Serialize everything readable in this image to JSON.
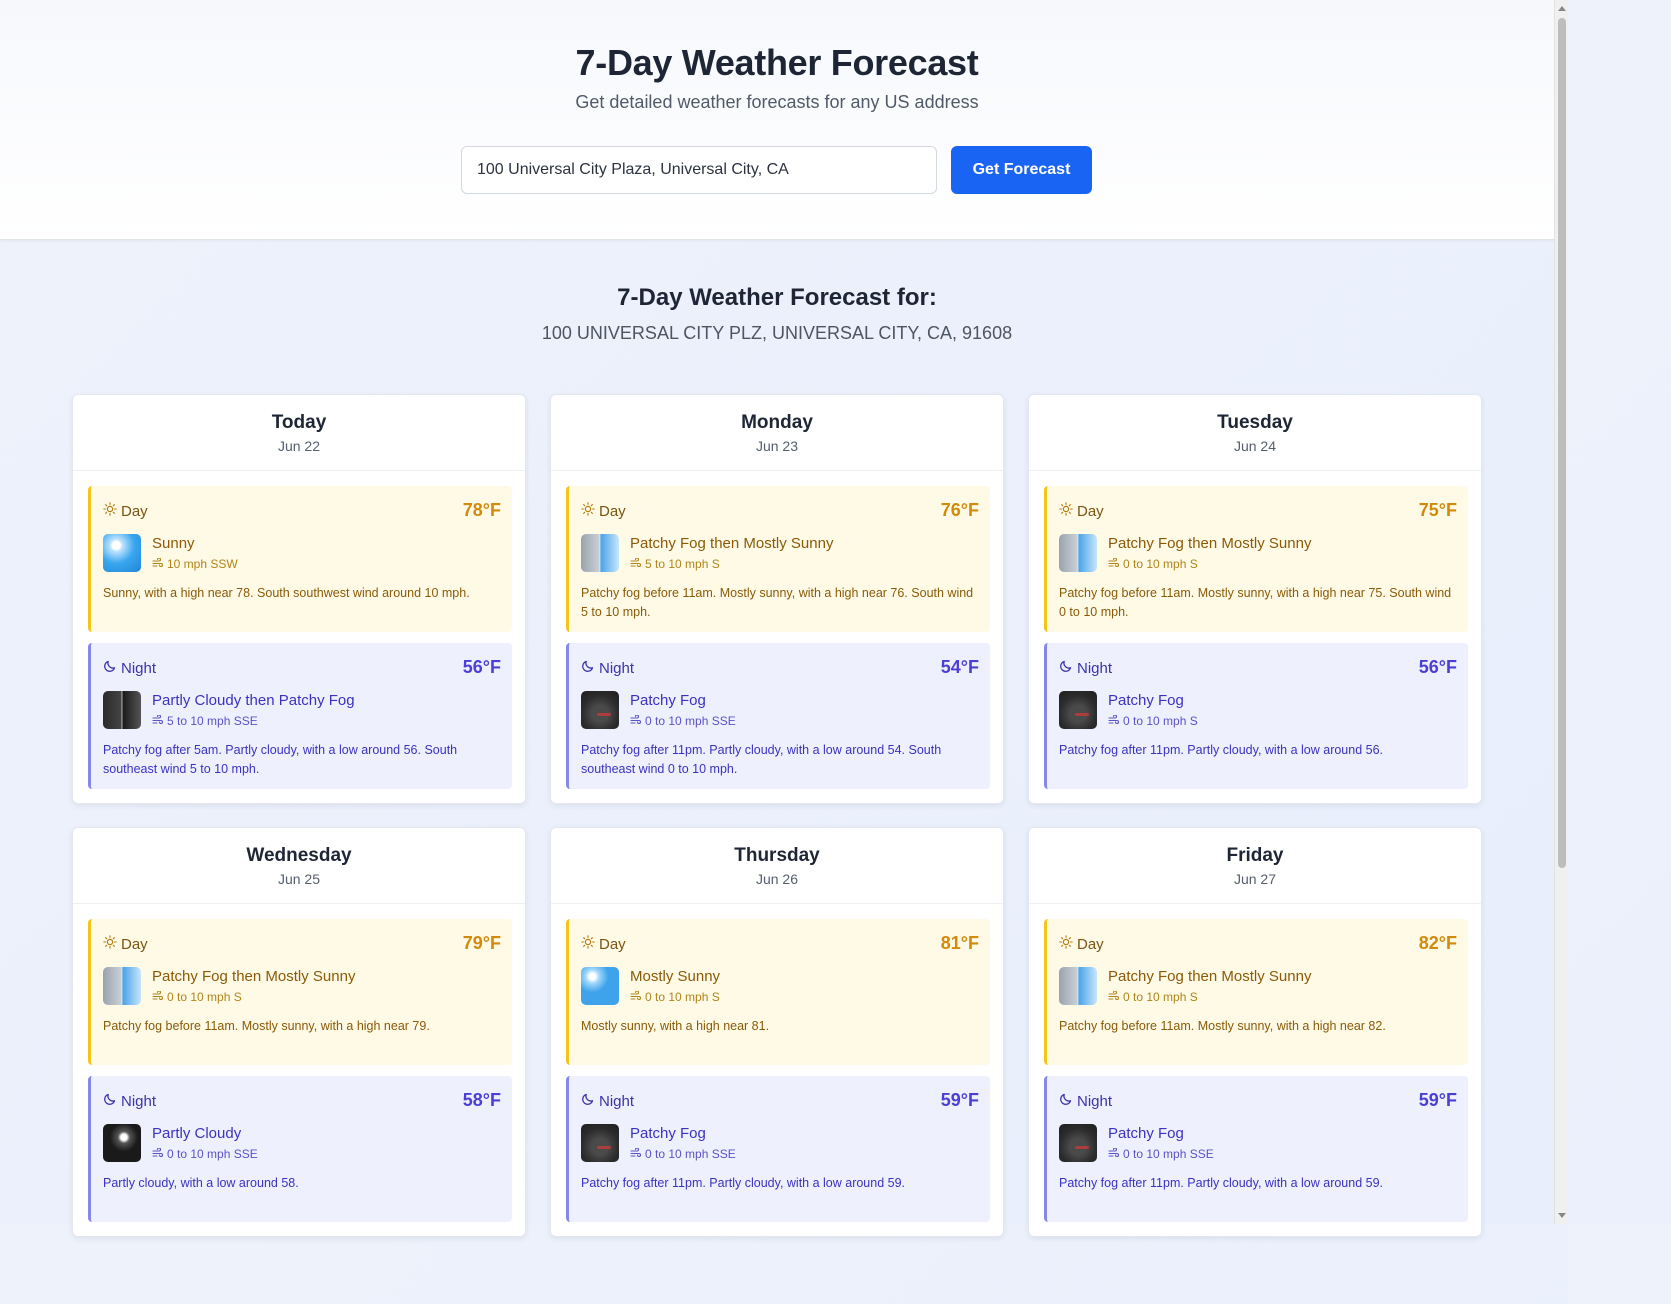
{
  "header": {
    "title": "7-Day Weather Forecast",
    "subtitle": "Get detailed weather forecasts for any US address",
    "search_value": "100 Universal City Plaza, Universal City, CA",
    "button_label": "Get Forecast"
  },
  "location": {
    "heading": "7-Day Weather Forecast for:",
    "address": "100 UNIVERSAL CITY PLZ, UNIVERSAL CITY, CA, 91608"
  },
  "labels": {
    "day": "Day",
    "night": "Night"
  },
  "colors": {
    "accent": "#1a64f4",
    "day_border": "#f4c419",
    "night_border": "#8787e8"
  },
  "days": [
    {
      "name": "Today",
      "date": "Jun 22",
      "day": {
        "temp": "78°F",
        "cond": "Sunny",
        "wind": "10 mph SSW",
        "desc": "Sunny, with a high near 78. South southwest wind around 10 mph.",
        "icon": "sunny-icon"
      },
      "night": {
        "temp": "56°F",
        "cond": "Partly Cloudy then Patchy Fog",
        "wind": "5 to 10 mph SSE",
        "desc": "Patchy fog after 5am. Partly cloudy, with a low around 56. South southeast wind 5 to 10 mph.",
        "icon": "partly-cloudy-fog-night-icon"
      }
    },
    {
      "name": "Monday",
      "date": "Jun 23",
      "day": {
        "temp": "76°F",
        "cond": "Patchy Fog then Mostly Sunny",
        "wind": "5 to 10 mph S",
        "desc": "Patchy fog before 11am. Mostly sunny, with a high near 76. South wind 5 to 10 mph.",
        "icon": "fog-sun-icon"
      },
      "night": {
        "temp": "54°F",
        "cond": "Patchy Fog",
        "wind": "0 to 10 mph SSE",
        "desc": "Patchy fog after 11pm. Partly cloudy, with a low around 54. South southeast wind 0 to 10 mph.",
        "icon": "fog-night-icon"
      }
    },
    {
      "name": "Tuesday",
      "date": "Jun 24",
      "day": {
        "temp": "75°F",
        "cond": "Patchy Fog then Mostly Sunny",
        "wind": "0 to 10 mph S",
        "desc": "Patchy fog before 11am. Mostly sunny, with a high near 75. South wind 0 to 10 mph.",
        "icon": "fog-sun-icon"
      },
      "night": {
        "temp": "56°F",
        "cond": "Patchy Fog",
        "wind": "0 to 10 mph S",
        "desc": "Patchy fog after 11pm. Partly cloudy, with a low around 56.",
        "icon": "fog-night-icon"
      }
    },
    {
      "name": "Wednesday",
      "date": "Jun 25",
      "day": {
        "temp": "79°F",
        "cond": "Patchy Fog then Mostly Sunny",
        "wind": "0 to 10 mph S",
        "desc": "Patchy fog before 11am. Mostly sunny, with a high near 79.",
        "icon": "fog-sun-icon"
      },
      "night": {
        "temp": "58°F",
        "cond": "Partly Cloudy",
        "wind": "0 to 10 mph SSE",
        "desc": "Partly cloudy, with a low around 58.",
        "icon": "partly-cloudy-night-icon"
      }
    },
    {
      "name": "Thursday",
      "date": "Jun 26",
      "day": {
        "temp": "81°F",
        "cond": "Mostly Sunny",
        "wind": "0 to 10 mph S",
        "desc": "Mostly sunny, with a high near 81.",
        "icon": "mostly-sunny-icon"
      },
      "night": {
        "temp": "59°F",
        "cond": "Patchy Fog",
        "wind": "0 to 10 mph SSE",
        "desc": "Patchy fog after 11pm. Partly cloudy, with a low around 59.",
        "icon": "fog-night-icon"
      }
    },
    {
      "name": "Friday",
      "date": "Jun 27",
      "day": {
        "temp": "82°F",
        "cond": "Patchy Fog then Mostly Sunny",
        "wind": "0 to 10 mph S",
        "desc": "Patchy fog before 11am. Mostly sunny, with a high near 82.",
        "icon": "fog-sun-icon"
      },
      "night": {
        "temp": "59°F",
        "cond": "Patchy Fog",
        "wind": "0 to 10 mph SSE",
        "desc": "Patchy fog after 11pm. Partly cloudy, with a low around 59.",
        "icon": "fog-night-icon"
      }
    }
  ]
}
